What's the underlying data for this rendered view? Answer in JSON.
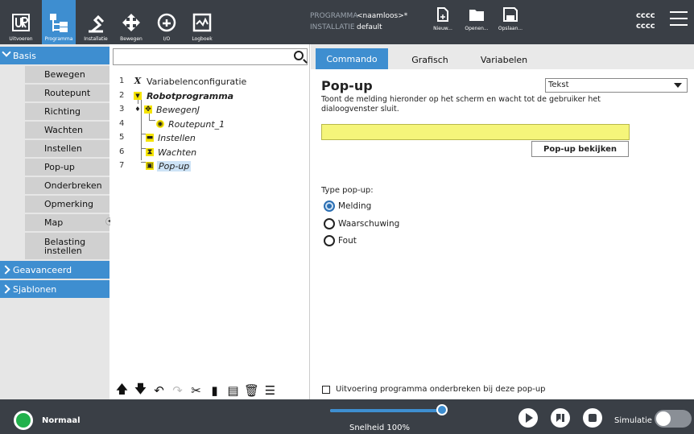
{
  "topbar": {
    "nav": [
      {
        "label": "Uitvoeren",
        "icon": "ur-logo-icon"
      },
      {
        "label": "Programma",
        "icon": "program-icon",
        "active": true
      },
      {
        "label": "Installatie",
        "icon": "installation-icon"
      },
      {
        "label": "Bewegen",
        "icon": "move-icon"
      },
      {
        "label": "I/O",
        "icon": "io-icon"
      },
      {
        "label": "Logboek",
        "icon": "log-icon"
      }
    ],
    "program_key": "PROGRAMMA",
    "program_value": "<naamloos>*",
    "installation_key": "INSTALLATIE",
    "installation_value": "default",
    "file_buttons": {
      "new": "Nieuw...",
      "open": "Openen...",
      "save": "Opslaan..."
    },
    "user_line1": "cccc",
    "user_line2": "cccc"
  },
  "sidebar": {
    "basis_label": "Basis",
    "items": [
      "Bewegen",
      "Routepunt",
      "Richting",
      "Wachten",
      "Instellen",
      "Pop-up",
      "Onderbreken",
      "Opmerking",
      "Map"
    ],
    "last_item_line1": "Belasting",
    "last_item_line2": "instellen",
    "advanced_label": "Geavanceerd",
    "templates_label": "Sjablonen"
  },
  "tree": {
    "search_placeholder": "",
    "lines": [
      {
        "num": "1",
        "text": "Variabelenconfiguratie"
      },
      {
        "num": "2",
        "text": "Robotprogramma"
      },
      {
        "num": "3",
        "text": "BewegenJ"
      },
      {
        "num": "4",
        "text": "Routepunt_1"
      },
      {
        "num": "5",
        "text": "Instellen"
      },
      {
        "num": "6",
        "text": "Wachten"
      },
      {
        "num": "7",
        "text": "Pop-up"
      }
    ]
  },
  "tabs": {
    "command": "Commando",
    "graphic": "Grafisch",
    "variables": "Variabelen"
  },
  "popup": {
    "title": "Pop-up",
    "description": "Toont de melding hieronder op het scherm en wacht tot de gebruiker het dialoogvenster sluit.",
    "type_select": "Tekst",
    "message_value": "",
    "preview_button": "Pop-up bekijken",
    "type_label": "Type pop-up:",
    "options": [
      "Melding",
      "Waarschuwing",
      "Fout"
    ],
    "selected_option": "Melding",
    "halt_checkbox_label": "Uitvoering programma onderbreken bij deze pop-up",
    "halt_checked": false
  },
  "bottombar": {
    "status": "Normaal",
    "speed_label": "Snelheid 100%",
    "speed_fraction": 1.0,
    "simulation_label": "Simulatie",
    "simulation_on": false
  },
  "colors": {
    "accent": "#3e8ed0",
    "dark": "#3a3f46",
    "message_bg": "#f5f57a",
    "status_green": "#22b14c"
  }
}
